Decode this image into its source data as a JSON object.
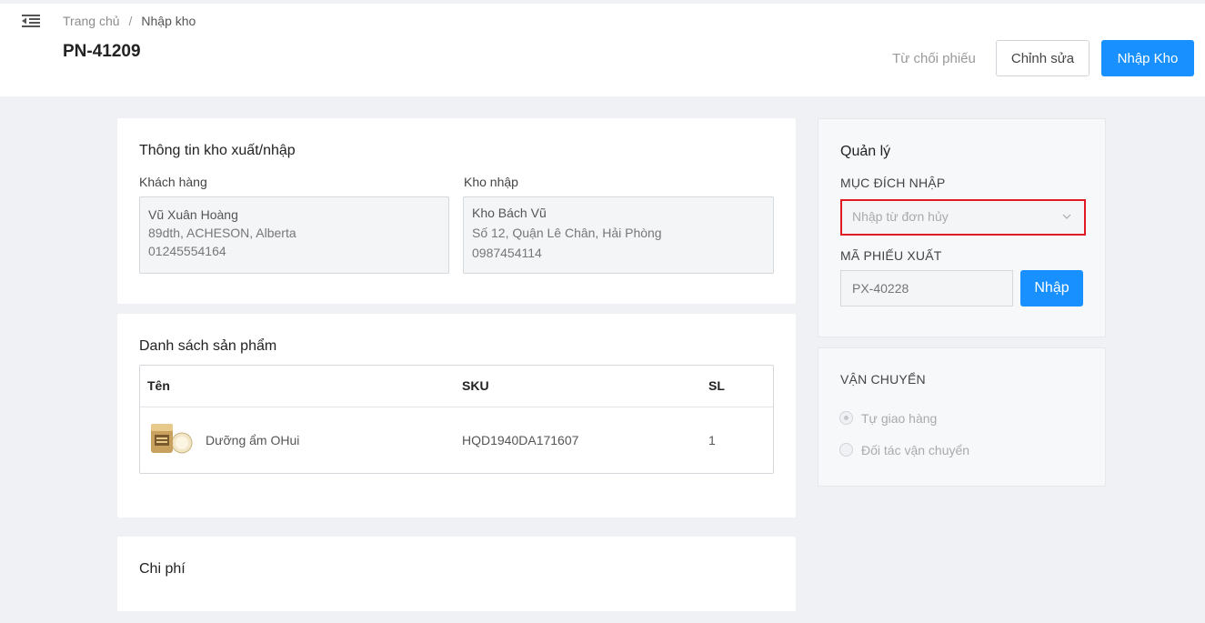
{
  "header": {
    "breadcrumb": {
      "home": "Trang chủ",
      "separator": "/",
      "current": "Nhập kho"
    },
    "title": "PN-41209",
    "actions": {
      "reject": "Từ chối phiếu",
      "edit": "Chỉnh sửa",
      "import": "Nhập Kho"
    }
  },
  "warehouse_info": {
    "title": "Thông tin kho xuất/nhập",
    "customer": {
      "label": "Khách hàng",
      "name": "Vũ Xuân Hoàng",
      "address": "89dth, ACHESON, Alberta",
      "phone": "01245554164"
    },
    "warehouse": {
      "label": "Kho nhập",
      "name": "Kho Bách Vũ",
      "address": "Số 12, Quận Lê Chân, Hải Phòng",
      "phone": "0987454114"
    }
  },
  "products": {
    "title": "Danh sách sản phẩm",
    "columns": {
      "name": "Tên",
      "sku": "SKU",
      "qty": "SL"
    },
    "rows": [
      {
        "name": "Dưỡng ẩm OHui",
        "sku": "HQD1940DA171607",
        "qty": "1"
      }
    ]
  },
  "costs": {
    "title": "Chi phí"
  },
  "management": {
    "title": "Quản lý",
    "purpose_label": "MỤC ĐÍCH NHẬP",
    "purpose_value": "Nhập từ đơn hủy",
    "code_label": "MÃ PHIẾU XUẤT",
    "code_placeholder": "PX-40228",
    "import_button": "Nhập"
  },
  "shipping": {
    "title": "VẬN CHUYỂN",
    "options": [
      {
        "label": "Tự giao hàng",
        "checked": true
      },
      {
        "label": "Đối tác vận chuyển",
        "checked": false
      }
    ]
  },
  "colors": {
    "primary": "#1890ff",
    "highlight": "#e01b24",
    "background": "#f0f1f4"
  }
}
